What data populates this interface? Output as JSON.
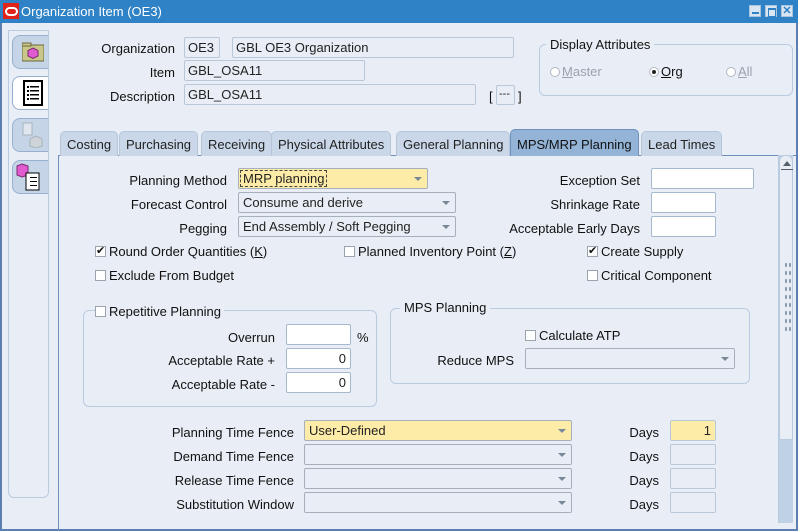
{
  "window": {
    "title": "Organization Item (OE3)",
    "controls": [
      "minimize",
      "maximize",
      "close"
    ]
  },
  "left_tray": {
    "tabs": [
      {
        "name": "organization-folder",
        "icon": "folder-cube-icon",
        "active": false
      },
      {
        "name": "attributes-list",
        "icon": "list-icon",
        "active": true
      },
      {
        "name": "organizations",
        "icon": "building-cube-icon",
        "active": false,
        "disabled": true
      },
      {
        "name": "item-list",
        "icon": "cube-list-icon",
        "active": false
      }
    ]
  },
  "header": {
    "organization_label": "Organization",
    "organization_code": "OE3",
    "organization_name": "GBL OE3 Organization",
    "item_label": "Item",
    "item_value": "GBL_OSA11",
    "description_label": "Description",
    "description_value": "GBL_OSA11",
    "dff_open": "[",
    "dff_value": "---",
    "dff_close": "]"
  },
  "display_attributes": {
    "title": "Display Attributes",
    "options": [
      {
        "label_mnemonic": "M",
        "label_rest": "aster",
        "selected": false,
        "enabled": false
      },
      {
        "label_mnemonic": "O",
        "label_rest": "rg",
        "selected": true,
        "enabled": true
      },
      {
        "label_mnemonic": "A",
        "label_rest": "ll",
        "selected": false,
        "enabled": false
      }
    ]
  },
  "tabs": [
    {
      "label": "Costing",
      "active": false
    },
    {
      "label": "Purchasing",
      "active": false
    },
    {
      "label": "Receiving",
      "active": false
    },
    {
      "label": "Physical Attributes",
      "active": false
    },
    {
      "label": "General Planning",
      "active": false
    },
    {
      "label": "MPS/MRP Planning",
      "active": true
    },
    {
      "label": "Lead Times",
      "active": false
    }
  ],
  "mrp": {
    "planning_method_label": "Planning Method",
    "planning_method_value": "MRP planning",
    "forecast_control_label": "Forecast Control",
    "forecast_control_value": "Consume and derive",
    "pegging_label": "Pegging",
    "pegging_value": "End Assembly / Soft Pegging",
    "exception_set_label": "Exception Set",
    "exception_set_value": "",
    "shrinkage_rate_label": "Shrinkage Rate",
    "shrinkage_rate_value": "",
    "acceptable_early_days_label": "Acceptable Early Days",
    "acceptable_early_days_value": "",
    "round_order_quantities": {
      "label": "Round Order Quantities (",
      "mnemonic": "K",
      "suffix": ")",
      "checked": true
    },
    "planned_inventory_point": {
      "label": "Planned Inventory Point (",
      "mnemonic": "Z",
      "suffix": ")",
      "checked": false
    },
    "create_supply": {
      "label": "Create Supply",
      "checked": true
    },
    "exclude_from_budget": {
      "label": "Exclude From Budget",
      "checked": false
    },
    "critical_component": {
      "label": "Critical Component",
      "checked": false
    }
  },
  "repetitive_planning": {
    "label": "Repetitive Planning",
    "checked": false,
    "overrun_label": "Overrun",
    "overrun_value": "",
    "overrun_unit": "%",
    "rate_plus_label": "Acceptable Rate +",
    "rate_plus_value": "0",
    "rate_minus_label": "Acceptable Rate -",
    "rate_minus_value": "0"
  },
  "mps_planning": {
    "title": "MPS Planning",
    "calculate_atp_label": "Calculate ATP",
    "calculate_atp_checked": false,
    "reduce_mps_label": "Reduce MPS",
    "reduce_mps_value": ""
  },
  "time_fences": {
    "days_label": "Days",
    "rows": [
      {
        "label": "Planning Time Fence",
        "value": "User-Defined",
        "days": "1"
      },
      {
        "label": "Demand Time Fence",
        "value": "",
        "days": ""
      },
      {
        "label": "Release Time Fence",
        "value": "",
        "days": ""
      },
      {
        "label": "Substitution Window",
        "value": "",
        "days": ""
      }
    ]
  },
  "colors": {
    "titlebar": "#2f82c6",
    "required_field": "#fdeca8",
    "active_tab": "#93b4d6",
    "background": "#e9eef6"
  }
}
